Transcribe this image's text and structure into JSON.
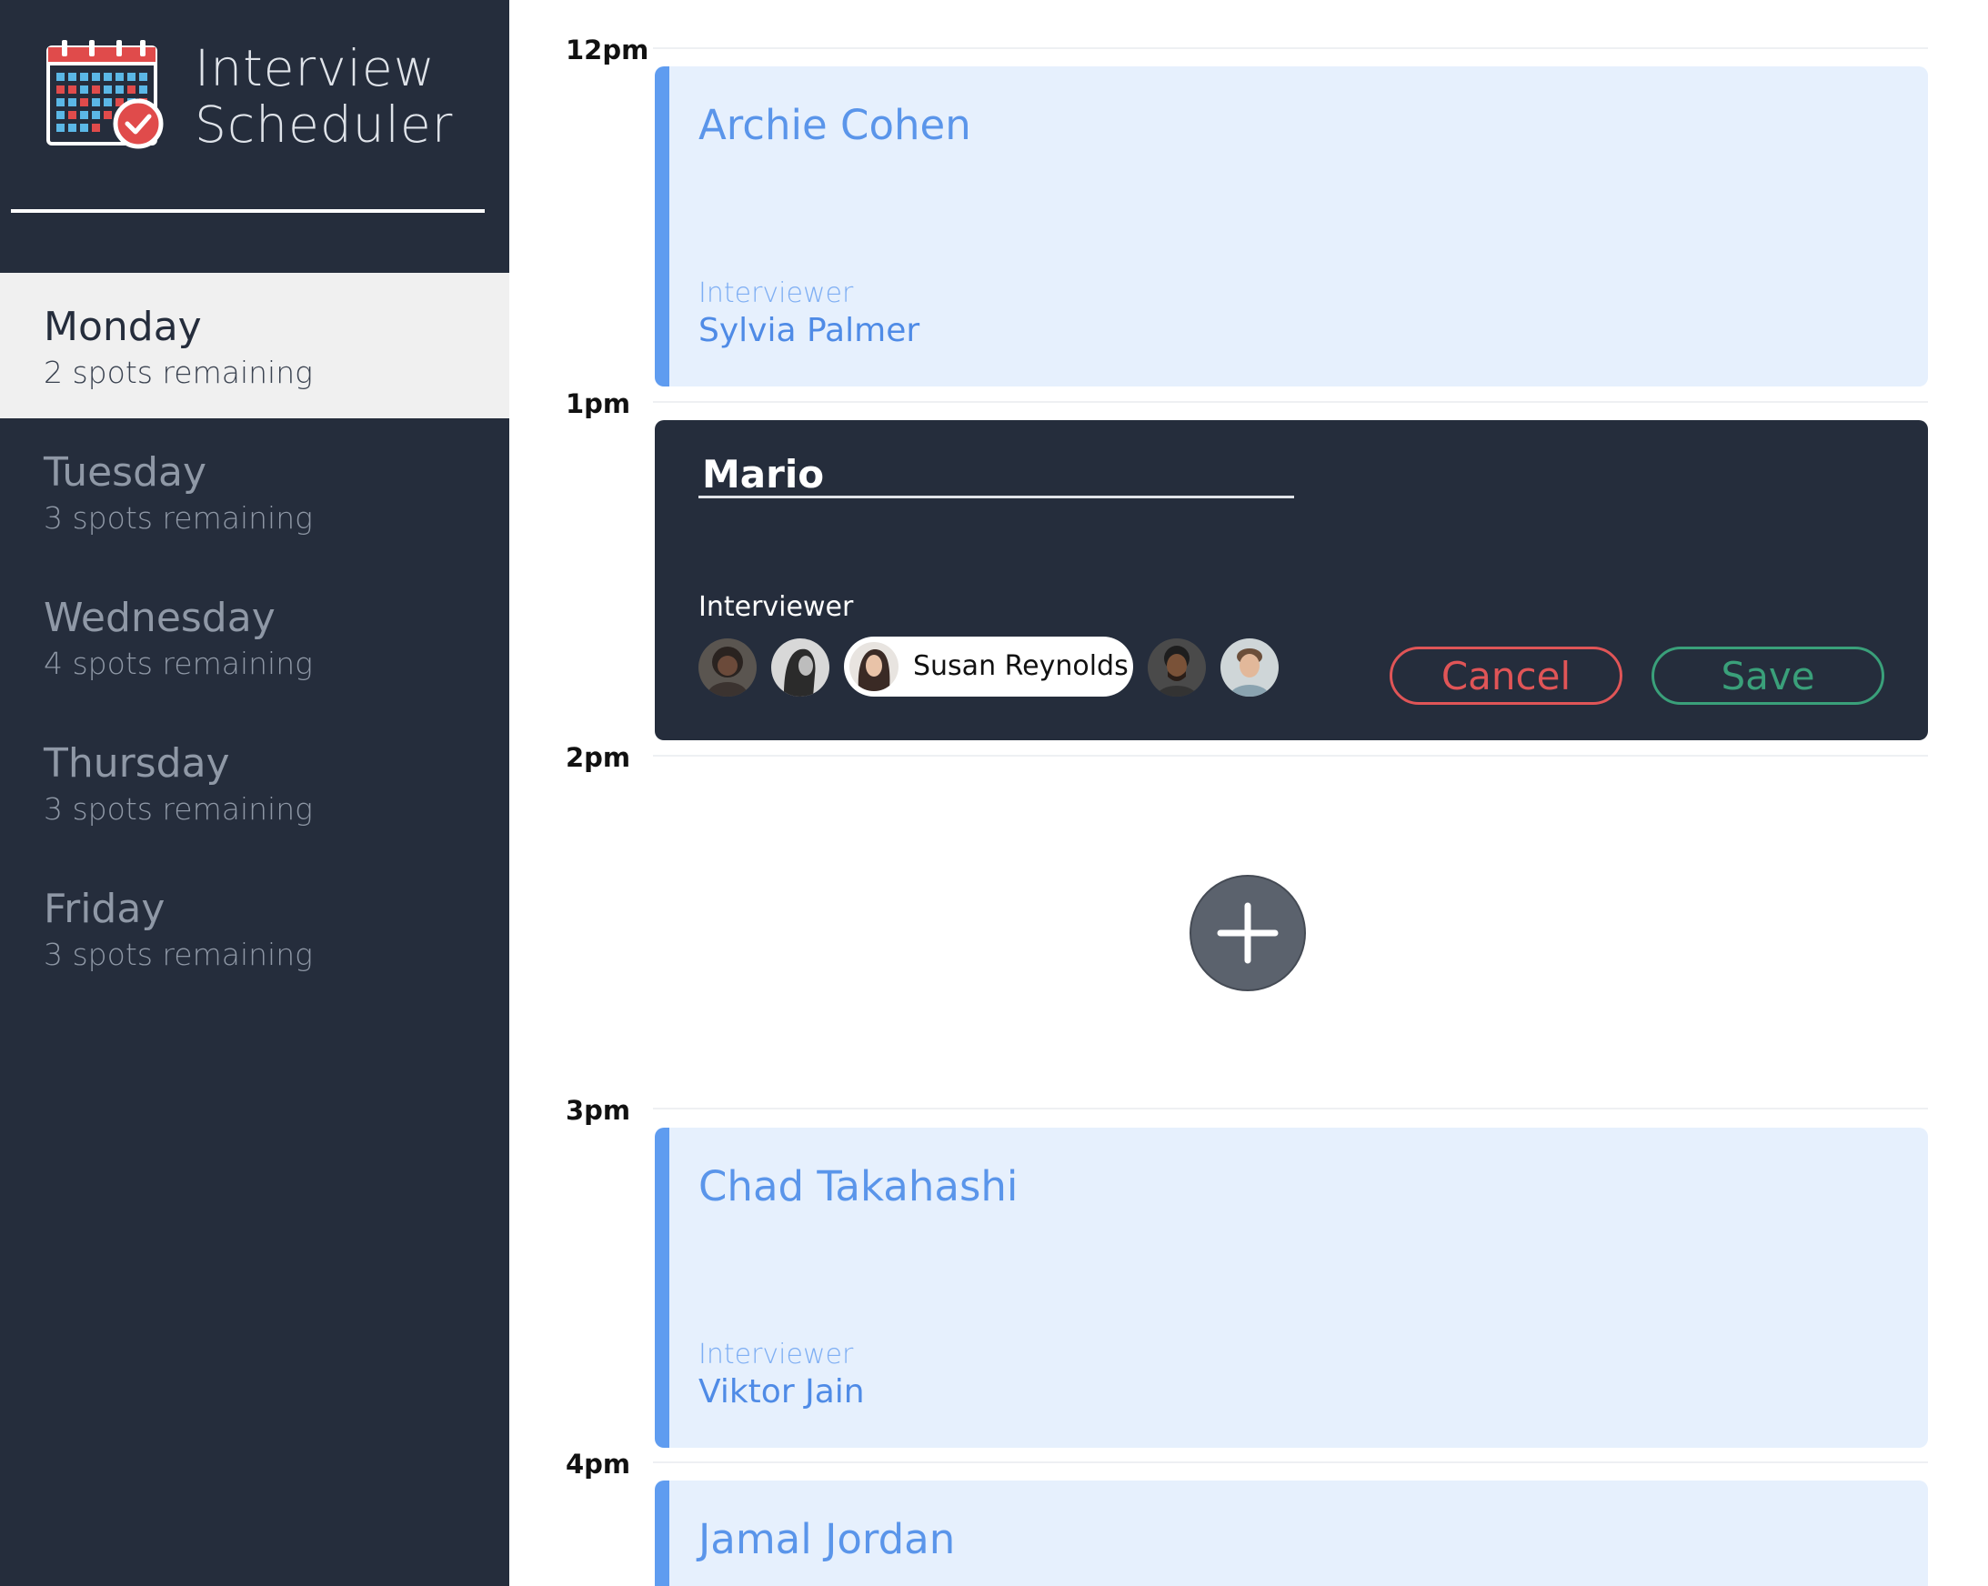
{
  "app": {
    "title_line1": "Interview",
    "title_line2": "Scheduler",
    "logo_icon": "calendar-check-icon"
  },
  "sidebar": {
    "days": [
      {
        "name": "Monday",
        "spots": "2 spots remaining",
        "active": true
      },
      {
        "name": "Tuesday",
        "spots": "3 spots remaining",
        "active": false
      },
      {
        "name": "Wednesday",
        "spots": "4 spots remaining",
        "active": false
      },
      {
        "name": "Thursday",
        "spots": "3 spots remaining",
        "active": false
      },
      {
        "name": "Friday",
        "spots": "3 spots remaining",
        "active": false
      }
    ]
  },
  "schedule": {
    "times": [
      "12pm",
      "1pm",
      "2pm",
      "3pm",
      "4pm"
    ],
    "appointments": [
      {
        "student": "Archie Cohen",
        "interviewer_label": "Interviewer",
        "interviewer": "Sylvia Palmer"
      },
      {
        "student": "Chad Takahashi",
        "interviewer_label": "Interviewer",
        "interviewer": "Viktor Jain"
      },
      {
        "student": "Jamal Jordan"
      }
    ],
    "editing": {
      "student_value": "Mario",
      "interviewer_label": "Interviewer",
      "selected_interviewer": "Susan Reynolds",
      "cancel_label": "Cancel",
      "save_label": "Save"
    },
    "add_icon": "plus-icon"
  },
  "colors": {
    "sidebar_bg": "#252d3c",
    "card_bg": "#e6f0fd",
    "card_accent": "#5f9cf0",
    "cancel": "#e05557",
    "save": "#3aa07a"
  }
}
